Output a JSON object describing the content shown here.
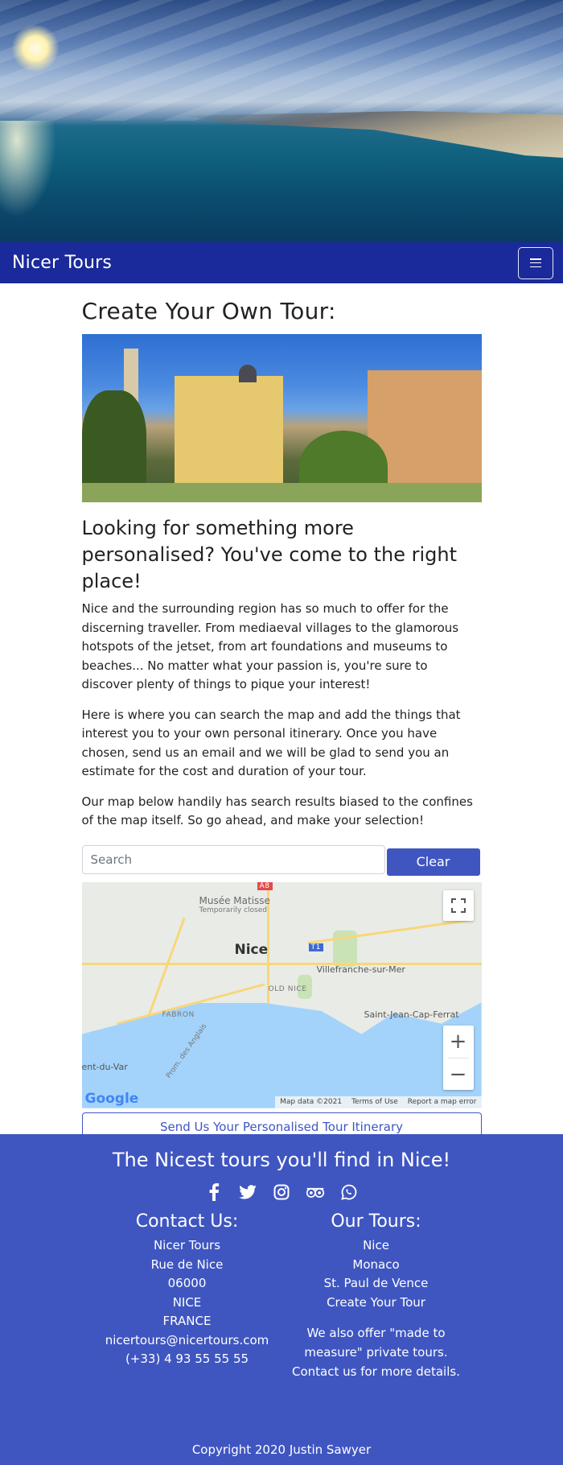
{
  "navbar": {
    "brand": "Nicer Tours"
  },
  "main": {
    "title": "Create Your Own Tour:",
    "subhead": "Looking for something more personalised? You've come to the right place!",
    "paragraphs": [
      "Nice and the surrounding region has so much to offer for the discerning traveller. From mediaeval villages to the glamorous hotspots of the jetset, from art foundations and museums to beaches... No matter what your passion is, you're sure to discover plenty of things to pique your interest!",
      "Here is where you can search the map and add the things that interest you to your own personal itinerary. Once you have chosen, send us an email and we will be glad to send you an estimate for the cost and duration of your tour.",
      "Our map below handily has search results biased to the confines of the map itself. So go ahead, and make your selection!"
    ],
    "search": {
      "placeholder": "Search",
      "value": ""
    },
    "clear_label": "Clear",
    "send_label": "Send Us Your Personalised Tour Itinerary"
  },
  "map": {
    "labels": {
      "musee": "Musée Matisse",
      "musee_sub": "Temporarily closed",
      "nice": "Nice",
      "old_nice": "OLD NICE",
      "fabron": "FABRON",
      "villefranche": "Villefranche-sur-Mer",
      "saint_jean": "Saint-Jean-Cap-Ferrat",
      "du_var": "ent-du-Var",
      "prom": "Prom. des Anglais",
      "a8": "A8",
      "t1": "T1"
    },
    "attribution": {
      "data": "Map data ©2021",
      "terms": "Terms of Use",
      "report": "Report a map error"
    },
    "logo": "Google",
    "zoom_in": "+",
    "zoom_out": "−"
  },
  "footer": {
    "tagline": "The Nicest tours you'll find in Nice!",
    "socials": [
      "facebook-icon",
      "twitter-icon",
      "instagram-icon",
      "tripadvisor-icon",
      "whatsapp-icon"
    ],
    "contact": {
      "heading": "Contact Us:",
      "lines": [
        "Nicer Tours",
        "Rue de Nice",
        "06000",
        "NICE",
        "FRANCE",
        "nicertours@nicertours.com",
        "(+33) 4 93 55 55 55"
      ]
    },
    "tours": {
      "heading": "Our Tours:",
      "lines": [
        "Nice",
        "Monaco",
        "St. Paul de Vence",
        "Create Your Tour"
      ],
      "note": "We also offer \"made to measure\" private tours. Contact us for more details."
    },
    "copyright": "Copyright 2020 Justin Sawyer"
  },
  "colors": {
    "navbar": "#1a2a9b",
    "accent": "#3f56c1"
  }
}
